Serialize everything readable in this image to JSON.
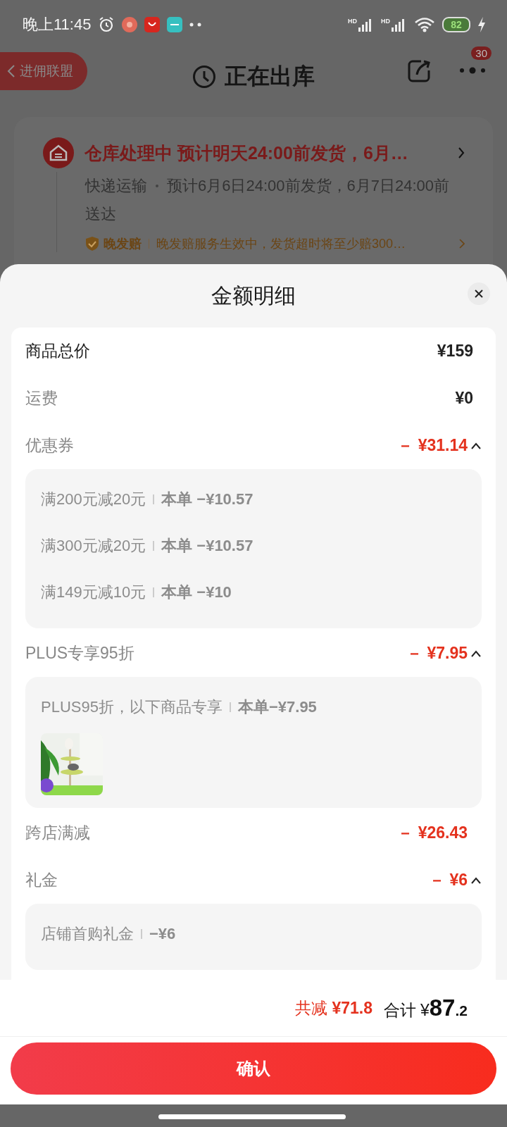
{
  "status_bar": {
    "time": "晚上11:45",
    "signal_labels": [
      "HD",
      "HD"
    ],
    "battery": "82"
  },
  "header": {
    "back_label": "进佣联盟",
    "title": "正在出库",
    "badge": "30"
  },
  "order_card": {
    "title": "仓库处理中 预计明天24:00前发货，6月…",
    "delivery_label": "快递运输",
    "delivery_text": "预计6月6日24:00前发货，6月7日24:00前送达",
    "guarantee_label": "晚发赔",
    "guarantee_text": "晚发赔服务生效中，发货超时将至少赔300…"
  },
  "sheet": {
    "title": "金额明细",
    "rows": [
      {
        "kind": "total",
        "label": "商品总价",
        "amount": "¥159"
      },
      {
        "kind": "fee",
        "label": "运费",
        "amount": "¥0"
      },
      {
        "kind": "discount",
        "label": "优惠券",
        "amount": "－ ¥31.14",
        "expanded": true,
        "details": [
          {
            "label": "满200元减20元",
            "amount": "本单 −¥10.57"
          },
          {
            "label": "满300元减20元",
            "amount": "本单 −¥10.57"
          },
          {
            "label": "满149元减10元",
            "amount": "本单 −¥10"
          }
        ]
      },
      {
        "kind": "discount",
        "label": "PLUS专享95折",
        "amount": "－ ¥7.95",
        "expanded": true,
        "details": [
          {
            "label": "PLUS95折，以下商品专享",
            "amount": "本单−¥7.95"
          }
        ],
        "pictures": [
          {
            "kind": "picture"
          }
        ]
      },
      {
        "kind": "discount",
        "label": "跨店满减",
        "amount": "－ ¥26.43"
      },
      {
        "kind": "discount",
        "label": "礼金",
        "amount": "－ ¥6",
        "expanded": true,
        "details": [
          {
            "label": "店铺首购礼金",
            "amount": "−¥6"
          }
        ]
      }
    ]
  },
  "footer": {
    "reduction_label": "共减",
    "reduction": "¥71.8",
    "total_label": "合计",
    "currency": "¥",
    "total_integer": "87",
    "total_decimal": ".2",
    "confirm": "确认"
  }
}
